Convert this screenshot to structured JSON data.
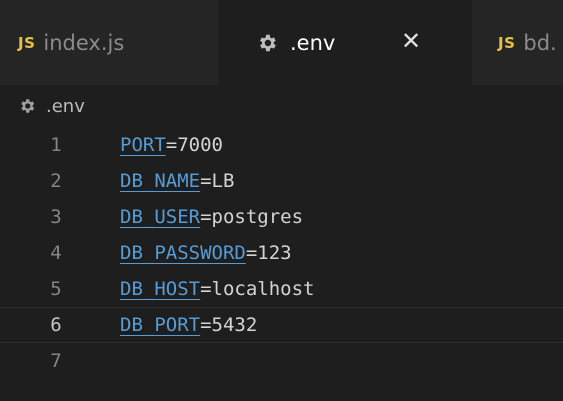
{
  "tabs": [
    {
      "icon": "JS",
      "label": "index.js",
      "active": false
    },
    {
      "icon": "gear-icon",
      "label": ".env",
      "active": true,
      "close": "✕"
    },
    {
      "icon": "JS",
      "label": "bd.",
      "active": false
    }
  ],
  "breadcrumb": {
    "label": ".env"
  },
  "editor": {
    "lines": [
      {
        "num": "1",
        "key": "PORT",
        "value": "7000"
      },
      {
        "num": "2",
        "key": "DB_NAME",
        "value": "LB"
      },
      {
        "num": "3",
        "key": "DB_USER",
        "value": "postgres"
      },
      {
        "num": "4",
        "key": "DB_PASSWORD",
        "value": "123"
      },
      {
        "num": "5",
        "key": "DB_HOST",
        "value": "localhost"
      },
      {
        "num": "6",
        "key": "DB_PORT",
        "value": "5432"
      },
      {
        "num": "7",
        "key": "",
        "value": ""
      }
    ],
    "current_line": "6"
  },
  "colors": {
    "background": "#1e1e1e",
    "tabbar": "#252526",
    "key": "#569cd6",
    "value": "#d4d4d4",
    "line_number": "#858585",
    "js_icon": "#e5c245"
  }
}
